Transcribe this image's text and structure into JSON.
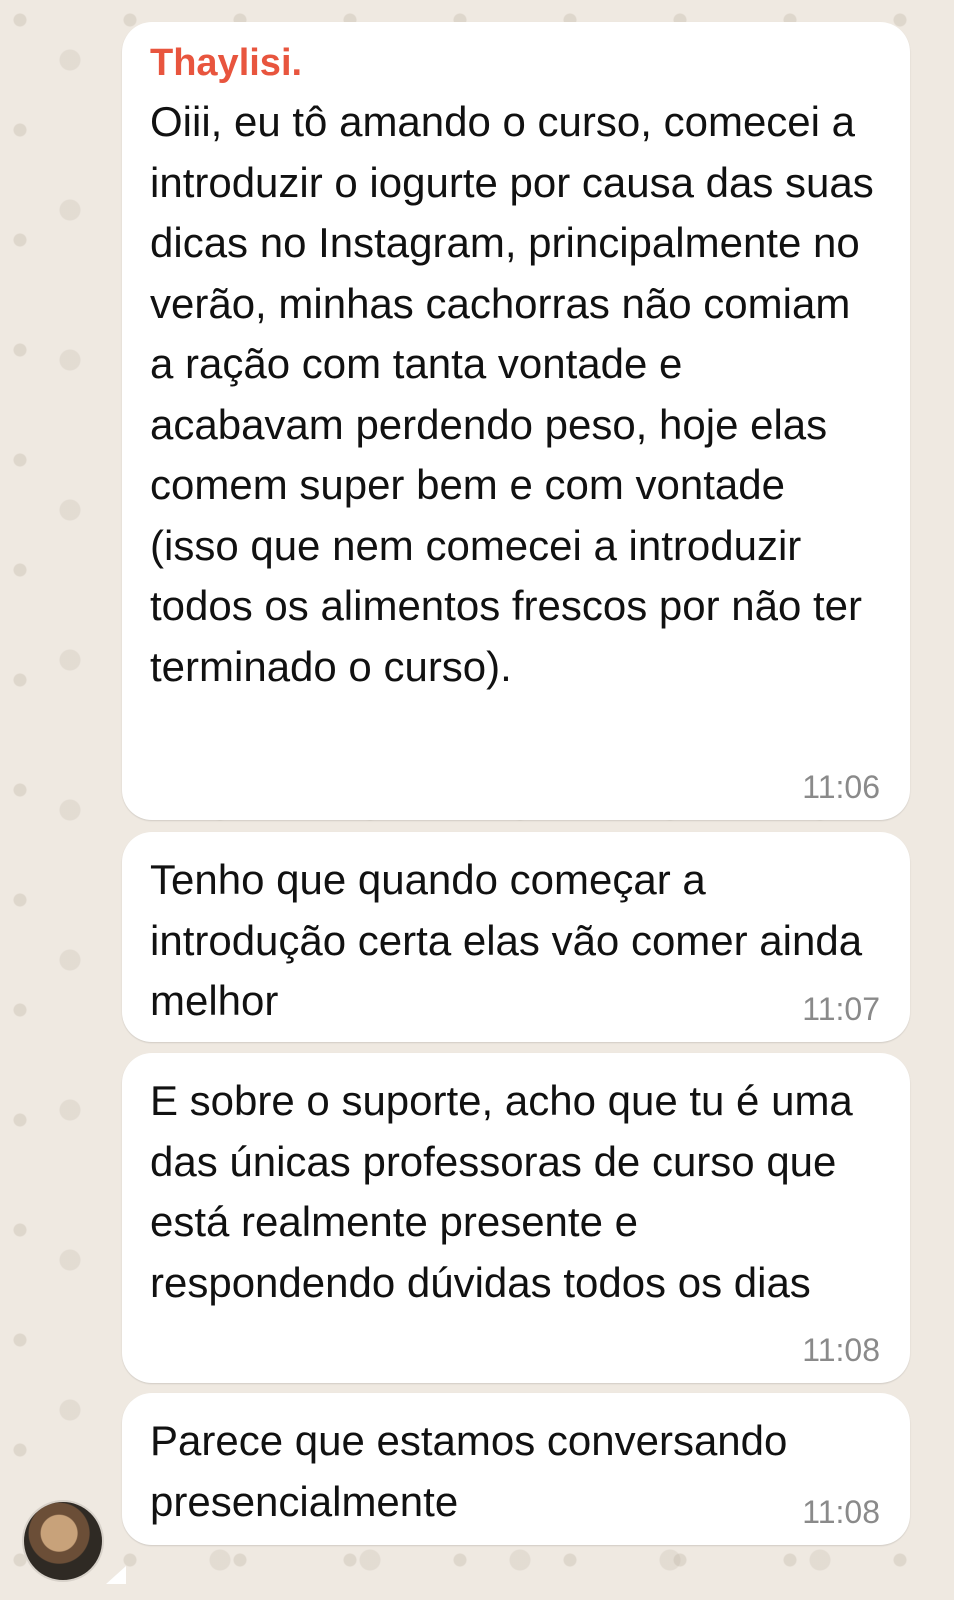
{
  "chat": {
    "sender_name": "Thaylisi.",
    "messages": [
      {
        "text": "Oiii, eu tô amando o curso, comecei a introduzir o iogurte por causa das suas dicas no Instagram, principalmente no verão, minhas cachorras não comiam a ração com tanta vontade e acabavam perdendo peso, hoje elas comem super bem e com vontade (isso que nem comecei a introduzir todos os alimentos frescos por não ter terminado o curso).",
        "time": "11:06"
      },
      {
        "text": "Tenho que quando começar a introdução certa elas vão comer ainda melhor",
        "time": "11:07"
      },
      {
        "text": "E sobre o suporte, acho que tu é uma das únicas professoras de curso que está realmente presente e respondendo dúvidas todos os dias",
        "time": "11:08"
      },
      {
        "text": "Parece que estamos conversando presencialmente",
        "time": "11:08"
      }
    ]
  },
  "colors": {
    "sender_name": "#e8553e",
    "bubble": "#ffffff",
    "wallpaper": "#efe9e1",
    "time": "#8a8a8a"
  },
  "icons": {
    "avatar": "contact-avatar-photo"
  }
}
